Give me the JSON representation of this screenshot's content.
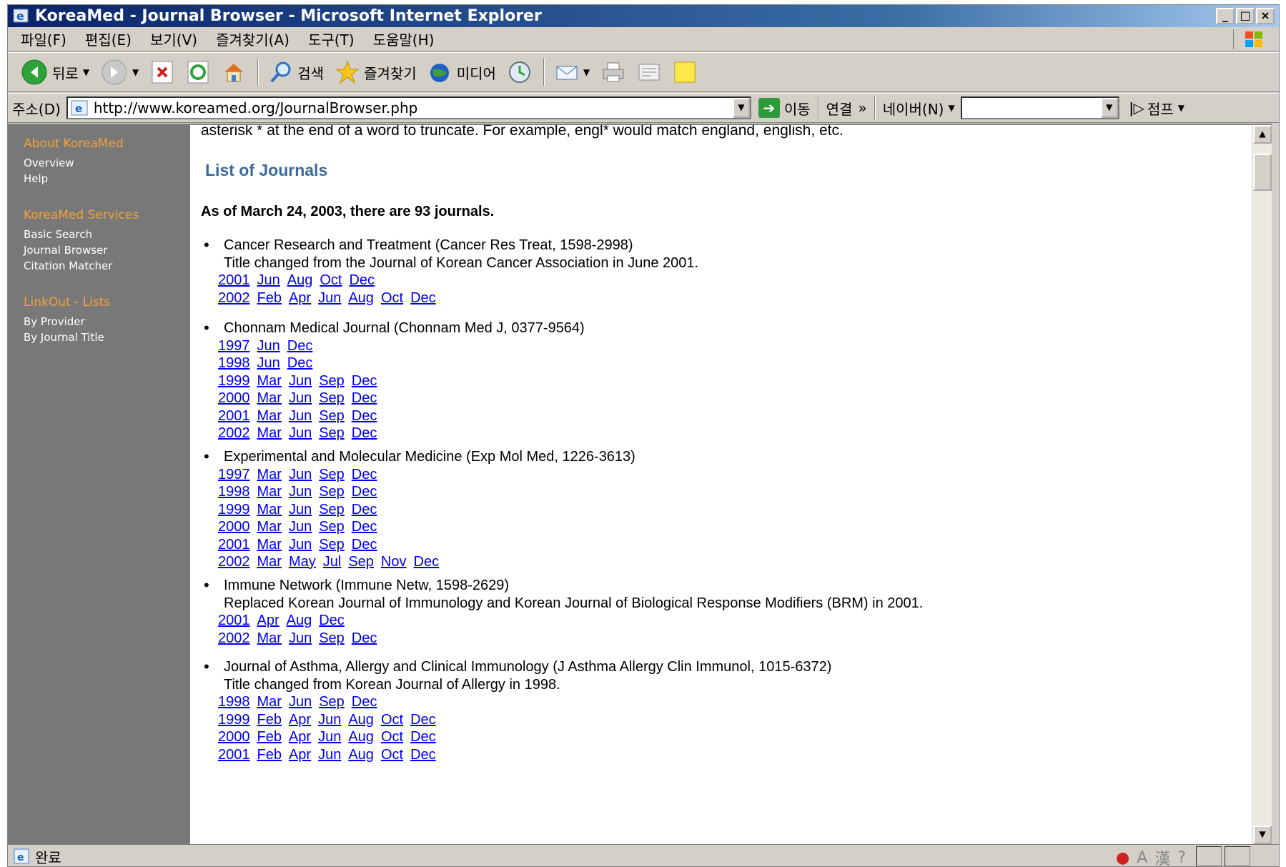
{
  "window": {
    "title": "KoreaMed - Journal Browser - Microsoft Internet Explorer",
    "controls": [
      "_",
      "□",
      "×"
    ]
  },
  "menu": [
    "파일(F)",
    "편집(E)",
    "보기(V)",
    "즐겨찾기(A)",
    "도구(T)",
    "도움말(H)"
  ],
  "toolbar": {
    "back": "뒤로",
    "search": "검색",
    "favorites": "즐겨찾기",
    "media": "미디어"
  },
  "address": {
    "label": "주소(D)",
    "url": "http://www.koreamed.org/JournalBrowser.php",
    "go": "이동",
    "links": "연결",
    "links_more": "»",
    "naver": "네이버(N)",
    "jump": "점프"
  },
  "sidebar": {
    "sections": [
      {
        "heading": "About KoreaMed",
        "links": [
          "Overview",
          "Help"
        ]
      },
      {
        "heading": "KoreaMed Services",
        "links": [
          "Basic Search",
          "Journal Browser",
          "Citation Matcher"
        ]
      },
      {
        "heading": "LinkOut - Lists",
        "links": [
          "By Provider",
          "By Journal Title"
        ]
      }
    ]
  },
  "main": {
    "intro": "asterisk * at the end of a word to truncate. For example, engl* would match england, english, etc.",
    "list_title": "List of Journals",
    "summary": "As of March 24, 2003, there are 93 journals.",
    "journals": [
      {
        "title": "Cancer Research and Treatment (Cancer Res Treat, 1598-2998)",
        "note": "Title changed from the Journal of Korean Cancer Association in June 2001.",
        "years": [
          [
            "2001",
            "Jun",
            "Aug",
            "Oct",
            "Dec"
          ],
          [
            "2002",
            "Feb",
            "Apr",
            "Jun",
            "Aug",
            "Oct",
            "Dec"
          ]
        ]
      },
      {
        "title": "Chonnam Medical Journal (Chonnam Med J, 0377-9564)",
        "note": "",
        "years": [
          [
            "1997",
            "Jun",
            "Dec"
          ],
          [
            "1998",
            "Jun",
            "Dec"
          ],
          [
            "1999",
            "Mar",
            "Jun",
            "Sep",
            "Dec"
          ],
          [
            "2000",
            "Mar",
            "Jun",
            "Sep",
            "Dec"
          ],
          [
            "2001",
            "Mar",
            "Jun",
            "Sep",
            "Dec"
          ],
          [
            "2002",
            "Mar",
            "Jun",
            "Sep",
            "Dec"
          ]
        ]
      },
      {
        "title": "Experimental and Molecular Medicine (Exp Mol Med, 1226-3613)",
        "note": "",
        "years": [
          [
            "1997",
            "Mar",
            "Jun",
            "Sep",
            "Dec"
          ],
          [
            "1998",
            "Mar",
            "Jun",
            "Sep",
            "Dec"
          ],
          [
            "1999",
            "Mar",
            "Jun",
            "Sep",
            "Dec"
          ],
          [
            "2000",
            "Mar",
            "Jun",
            "Sep",
            "Dec"
          ],
          [
            "2001",
            "Mar",
            "Jun",
            "Sep",
            "Dec"
          ],
          [
            "2002",
            "Mar",
            "May",
            "Jul",
            "Sep",
            "Nov",
            "Dec"
          ]
        ]
      },
      {
        "title": "Immune Network (Immune Netw, 1598-2629)",
        "note": "Replaced Korean Journal of Immunology and Korean Journal of Biological Response Modifiers (BRM) in 2001.",
        "years": [
          [
            "2001",
            "Apr",
            "Aug",
            "Dec"
          ],
          [
            "2002",
            "Mar",
            "Jun",
            "Sep",
            "Dec"
          ]
        ]
      },
      {
        "title": "Journal of Asthma, Allergy and Clinical Immunology (J Asthma Allergy Clin Immunol, 1015-6372)",
        "note": "Title changed from Korean Journal of Allergy in 1998.",
        "years": [
          [
            "1998",
            "Mar",
            "Jun",
            "Sep",
            "Dec"
          ],
          [
            "1999",
            "Feb",
            "Apr",
            "Jun",
            "Aug",
            "Oct",
            "Dec"
          ],
          [
            "2000",
            "Feb",
            "Apr",
            "Jun",
            "Aug",
            "Oct",
            "Dec"
          ],
          [
            "2001",
            "Feb",
            "Apr",
            "Jun",
            "Aug",
            "Oct",
            "Dec"
          ]
        ]
      }
    ]
  },
  "status": {
    "text": "완료"
  }
}
